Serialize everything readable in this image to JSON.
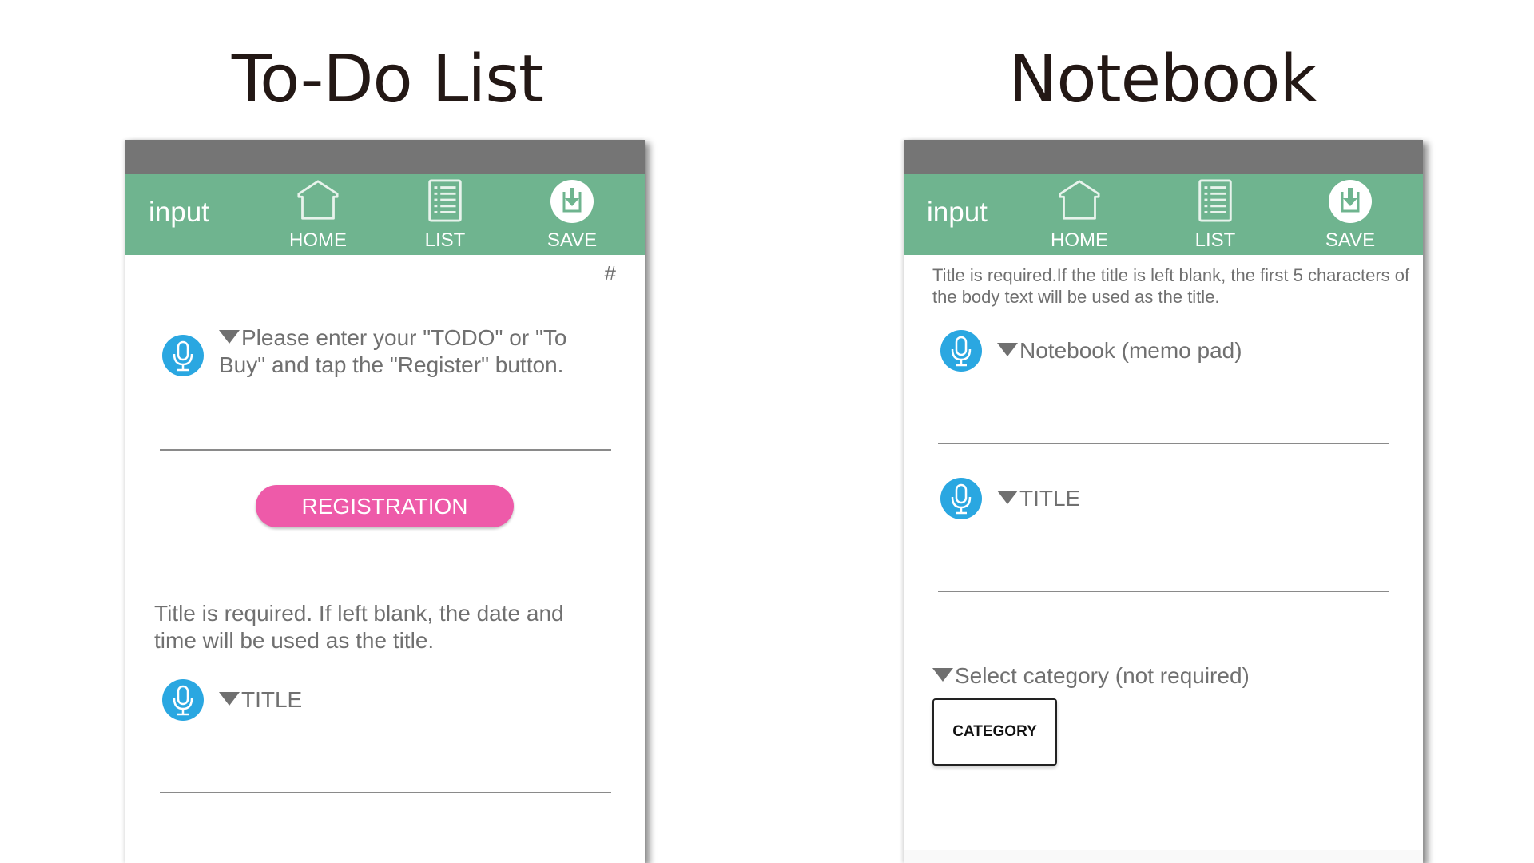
{
  "headings": {
    "left": "To-Do List",
    "right": "Notebook"
  },
  "todo": {
    "appbar": {
      "title": "input",
      "nav": [
        {
          "label": "HOME",
          "icon": "home-icon"
        },
        {
          "label": "LIST",
          "icon": "list-icon"
        },
        {
          "label": "SAVE",
          "icon": "save-icon"
        }
      ]
    },
    "hash": "#",
    "todo_field": {
      "label": "Please enter your \"TODO\" or \"To Buy\" and tap the \"Register\" button.",
      "value": "",
      "icon": "microphone-icon"
    },
    "register_button": "REGISTRATION",
    "title_note": "Title is required. If left blank, the date and time will be used as the title.",
    "title_field": {
      "label": "TITLE",
      "value": "",
      "icon": "microphone-icon"
    }
  },
  "notebook": {
    "appbar": {
      "title": "input",
      "nav": [
        {
          "label": "HOME",
          "icon": "home-icon"
        },
        {
          "label": "LIST",
          "icon": "list-icon"
        },
        {
          "label": "SAVE",
          "icon": "save-icon"
        }
      ]
    },
    "title_note": "Title is required.If the title is left blank, the first 5 characters of the body text will be used as the title.",
    "body_field": {
      "label": "Notebook (memo pad)",
      "value": "",
      "icon": "microphone-icon"
    },
    "title_field": {
      "label": "TITLE",
      "value": "",
      "icon": "microphone-icon"
    },
    "category_label": "Select category (not required)",
    "category_button": "CATEGORY"
  },
  "colors": {
    "appbar": "#6fb48f",
    "statusbar": "#757575",
    "accent_pink": "#ee5aa9",
    "mic_blue": "#2aa7e1",
    "text_gray": "#707070"
  }
}
